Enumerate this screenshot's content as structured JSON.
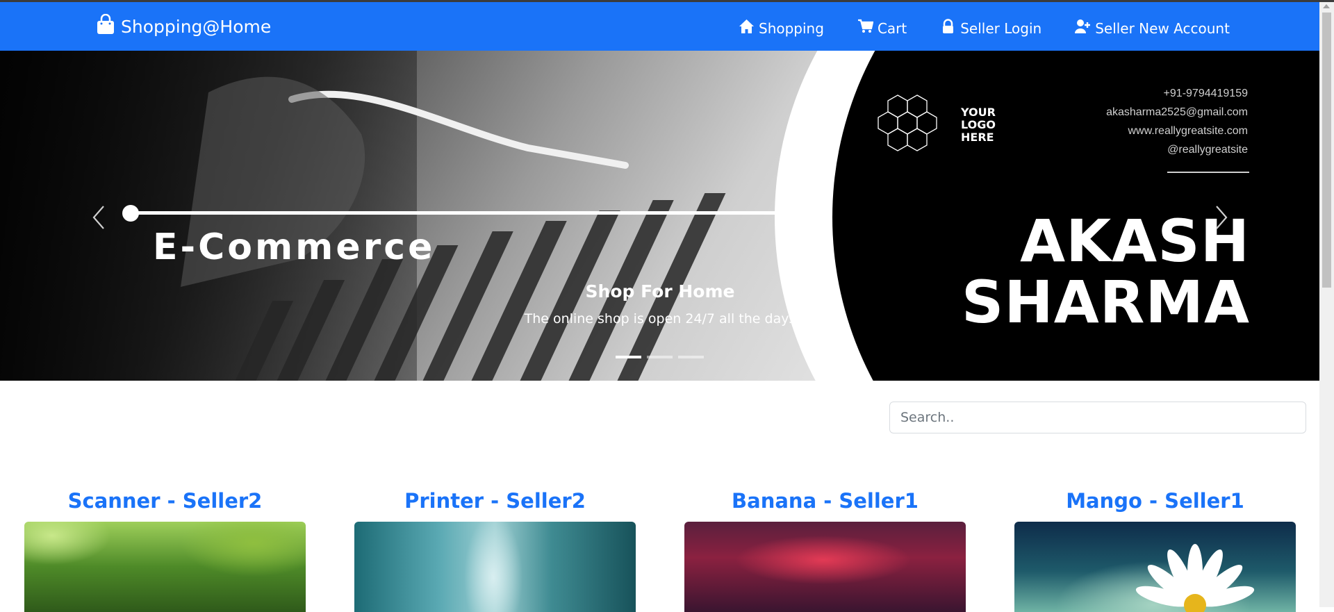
{
  "navbar": {
    "brand": "Shopping@Home",
    "brand_icon": "shopping-bag-icon",
    "items": [
      {
        "label": "Shopping",
        "icon": "home-icon"
      },
      {
        "label": "Cart",
        "icon": "cart-icon"
      },
      {
        "label": "Seller Login",
        "icon": "lock-icon"
      },
      {
        "label": "Seller New Account",
        "icon": "user-plus-icon"
      }
    ],
    "color": "#1a73f8"
  },
  "carousel": {
    "banner": {
      "heading": "E-Commerce",
      "logo_text": [
        "YOUR",
        "LOGO",
        "HERE"
      ],
      "contacts": [
        "+91-9794419159",
        "akasharma2525@gmail.com",
        "www.reallygreatsite.com",
        "@reallygreatsite"
      ],
      "name_lines": [
        "AKASH",
        "SHARMA"
      ]
    },
    "caption_title": "Shop For Home",
    "caption_text": "The online shop is open 24/7 all the days",
    "slide_count": 3,
    "active_slide": 1,
    "prev_icon": "chevron-left-icon",
    "next_icon": "chevron-right-icon"
  },
  "search": {
    "placeholder": "Search..",
    "value": ""
  },
  "products": [
    {
      "title": "Scanner - Seller2",
      "image": "forest-image"
    },
    {
      "title": "Printer - Seller2",
      "image": "rain-window-image"
    },
    {
      "title": "Banana - Seller1",
      "image": "red-sky-image"
    },
    {
      "title": "Mango - Seller1",
      "image": "daisy-image"
    }
  ]
}
